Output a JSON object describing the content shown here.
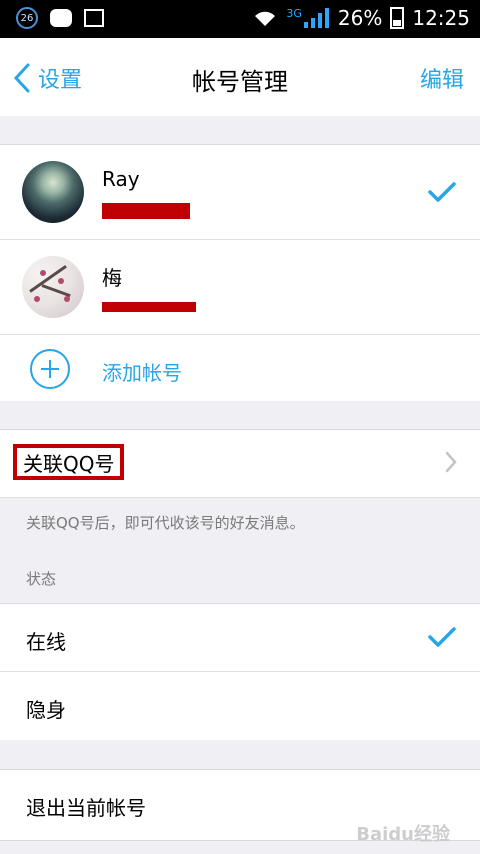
{
  "status_bar": {
    "notif_count": "26",
    "network": "3G",
    "battery": "26%",
    "time": "12:25"
  },
  "header": {
    "back_label": "设置",
    "title": "帐号管理",
    "edit_label": "编辑"
  },
  "accounts": [
    {
      "name": "Ray",
      "selected": true
    },
    {
      "name": "梅",
      "selected": false
    }
  ],
  "add_account_label": "添加帐号",
  "link_qq": {
    "label": "关联QQ号",
    "hint": "关联QQ号后，即可代收该号的好友消息。"
  },
  "status_section": {
    "label": "状态",
    "options": [
      {
        "label": "在线",
        "selected": true
      },
      {
        "label": "隐身",
        "selected": false
      }
    ]
  },
  "logout_label": "退出当前帐号",
  "watermark": "Baidu经验",
  "colors": {
    "accent": "#26a6e6",
    "redaction": "#c00000",
    "background": "#efeff4"
  }
}
